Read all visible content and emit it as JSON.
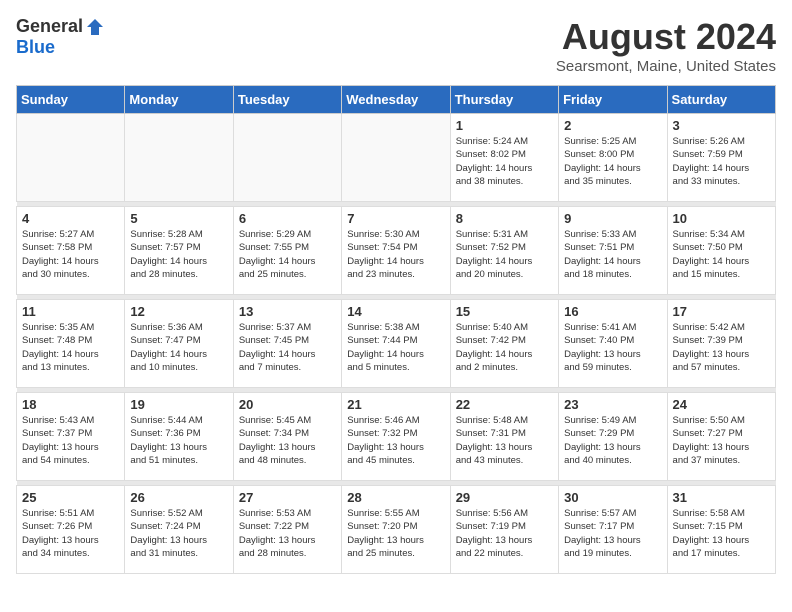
{
  "header": {
    "logo_general": "General",
    "logo_blue": "Blue",
    "title": "August 2024",
    "location": "Searsmont, Maine, United States"
  },
  "days_of_week": [
    "Sunday",
    "Monday",
    "Tuesday",
    "Wednesday",
    "Thursday",
    "Friday",
    "Saturday"
  ],
  "weeks": [
    [
      {
        "day": "",
        "info": ""
      },
      {
        "day": "",
        "info": ""
      },
      {
        "day": "",
        "info": ""
      },
      {
        "day": "",
        "info": ""
      },
      {
        "day": "1",
        "info": "Sunrise: 5:24 AM\nSunset: 8:02 PM\nDaylight: 14 hours\nand 38 minutes."
      },
      {
        "day": "2",
        "info": "Sunrise: 5:25 AM\nSunset: 8:00 PM\nDaylight: 14 hours\nand 35 minutes."
      },
      {
        "day": "3",
        "info": "Sunrise: 5:26 AM\nSunset: 7:59 PM\nDaylight: 14 hours\nand 33 minutes."
      }
    ],
    [
      {
        "day": "4",
        "info": "Sunrise: 5:27 AM\nSunset: 7:58 PM\nDaylight: 14 hours\nand 30 minutes."
      },
      {
        "day": "5",
        "info": "Sunrise: 5:28 AM\nSunset: 7:57 PM\nDaylight: 14 hours\nand 28 minutes."
      },
      {
        "day": "6",
        "info": "Sunrise: 5:29 AM\nSunset: 7:55 PM\nDaylight: 14 hours\nand 25 minutes."
      },
      {
        "day": "7",
        "info": "Sunrise: 5:30 AM\nSunset: 7:54 PM\nDaylight: 14 hours\nand 23 minutes."
      },
      {
        "day": "8",
        "info": "Sunrise: 5:31 AM\nSunset: 7:52 PM\nDaylight: 14 hours\nand 20 minutes."
      },
      {
        "day": "9",
        "info": "Sunrise: 5:33 AM\nSunset: 7:51 PM\nDaylight: 14 hours\nand 18 minutes."
      },
      {
        "day": "10",
        "info": "Sunrise: 5:34 AM\nSunset: 7:50 PM\nDaylight: 14 hours\nand 15 minutes."
      }
    ],
    [
      {
        "day": "11",
        "info": "Sunrise: 5:35 AM\nSunset: 7:48 PM\nDaylight: 14 hours\nand 13 minutes."
      },
      {
        "day": "12",
        "info": "Sunrise: 5:36 AM\nSunset: 7:47 PM\nDaylight: 14 hours\nand 10 minutes."
      },
      {
        "day": "13",
        "info": "Sunrise: 5:37 AM\nSunset: 7:45 PM\nDaylight: 14 hours\nand 7 minutes."
      },
      {
        "day": "14",
        "info": "Sunrise: 5:38 AM\nSunset: 7:44 PM\nDaylight: 14 hours\nand 5 minutes."
      },
      {
        "day": "15",
        "info": "Sunrise: 5:40 AM\nSunset: 7:42 PM\nDaylight: 14 hours\nand 2 minutes."
      },
      {
        "day": "16",
        "info": "Sunrise: 5:41 AM\nSunset: 7:40 PM\nDaylight: 13 hours\nand 59 minutes."
      },
      {
        "day": "17",
        "info": "Sunrise: 5:42 AM\nSunset: 7:39 PM\nDaylight: 13 hours\nand 57 minutes."
      }
    ],
    [
      {
        "day": "18",
        "info": "Sunrise: 5:43 AM\nSunset: 7:37 PM\nDaylight: 13 hours\nand 54 minutes."
      },
      {
        "day": "19",
        "info": "Sunrise: 5:44 AM\nSunset: 7:36 PM\nDaylight: 13 hours\nand 51 minutes."
      },
      {
        "day": "20",
        "info": "Sunrise: 5:45 AM\nSunset: 7:34 PM\nDaylight: 13 hours\nand 48 minutes."
      },
      {
        "day": "21",
        "info": "Sunrise: 5:46 AM\nSunset: 7:32 PM\nDaylight: 13 hours\nand 45 minutes."
      },
      {
        "day": "22",
        "info": "Sunrise: 5:48 AM\nSunset: 7:31 PM\nDaylight: 13 hours\nand 43 minutes."
      },
      {
        "day": "23",
        "info": "Sunrise: 5:49 AM\nSunset: 7:29 PM\nDaylight: 13 hours\nand 40 minutes."
      },
      {
        "day": "24",
        "info": "Sunrise: 5:50 AM\nSunset: 7:27 PM\nDaylight: 13 hours\nand 37 minutes."
      }
    ],
    [
      {
        "day": "25",
        "info": "Sunrise: 5:51 AM\nSunset: 7:26 PM\nDaylight: 13 hours\nand 34 minutes."
      },
      {
        "day": "26",
        "info": "Sunrise: 5:52 AM\nSunset: 7:24 PM\nDaylight: 13 hours\nand 31 minutes."
      },
      {
        "day": "27",
        "info": "Sunrise: 5:53 AM\nSunset: 7:22 PM\nDaylight: 13 hours\nand 28 minutes."
      },
      {
        "day": "28",
        "info": "Sunrise: 5:55 AM\nSunset: 7:20 PM\nDaylight: 13 hours\nand 25 minutes."
      },
      {
        "day": "29",
        "info": "Sunrise: 5:56 AM\nSunset: 7:19 PM\nDaylight: 13 hours\nand 22 minutes."
      },
      {
        "day": "30",
        "info": "Sunrise: 5:57 AM\nSunset: 7:17 PM\nDaylight: 13 hours\nand 19 minutes."
      },
      {
        "day": "31",
        "info": "Sunrise: 5:58 AM\nSunset: 7:15 PM\nDaylight: 13 hours\nand 17 minutes."
      }
    ]
  ]
}
